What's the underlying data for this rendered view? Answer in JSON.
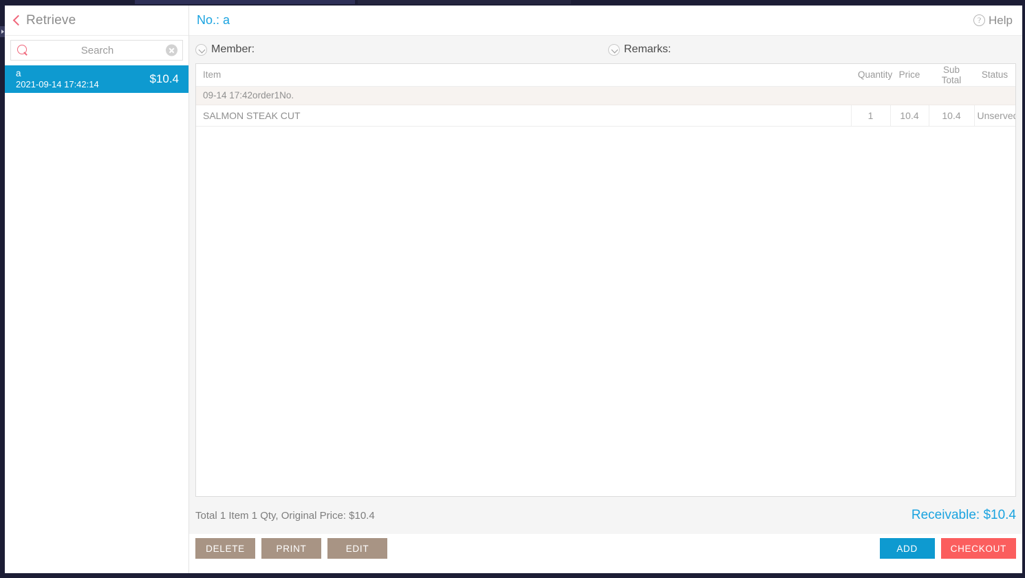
{
  "sidebar": {
    "back_icon": "chevron-left-icon",
    "title": "Retrieve",
    "search": {
      "icon": "search-icon",
      "placeholder": "Search",
      "value": "",
      "clear_icon": "close-circle-icon"
    },
    "orders": [
      {
        "name": "a",
        "time": "2021-09-14 17:42:14",
        "amount": "$10.4",
        "selected": true
      }
    ]
  },
  "header": {
    "order_no_label": "No.: a",
    "help": {
      "icon": "question-circle-icon",
      "label": "Help"
    }
  },
  "meta": {
    "member": {
      "icon": "chevron-down-circle-icon",
      "label": "Member:",
      "value": ""
    },
    "remarks": {
      "icon": "chevron-down-circle-icon",
      "label": "Remarks:",
      "value": ""
    }
  },
  "items_table": {
    "columns": [
      "Item",
      "Quantity",
      "Price",
      "Sub Total",
      "Status"
    ],
    "group_row_label": "09-14 17:42order1No.",
    "rows": [
      {
        "item": "SALMON STEAK CUT",
        "quantity": "1",
        "price": "10.4",
        "sub_total": "10.4",
        "status": "Unserved"
      }
    ]
  },
  "totals": {
    "summary": "Total 1 Item 1 Qty, Original Price: $10.4",
    "receivable": "Receivable: $10.4"
  },
  "footer": {
    "delete_label": "DELETE",
    "print_label": "PRINT",
    "edit_label": "EDIT",
    "add_label": "ADD",
    "checkout_label": "CHECKOUT"
  },
  "colors": {
    "accent_blue": "#0e9ad0",
    "link_blue": "#1aa3e0",
    "danger_red": "#fb5e5e",
    "secondary_taupe": "#a89484",
    "pink_icon": "#f0667a",
    "chrome_navy": "#1c1d35"
  }
}
